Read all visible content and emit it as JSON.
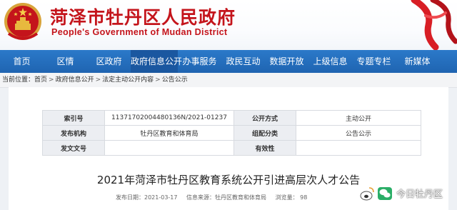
{
  "header": {
    "title": "菏泽市牡丹区人民政府",
    "subtitle": "People's Government of Mudan District"
  },
  "nav": {
    "items": [
      {
        "label": "首页"
      },
      {
        "label": "区情"
      },
      {
        "label": "区政府"
      },
      {
        "label": "政府信息公开"
      },
      {
        "label": "办事服务"
      },
      {
        "label": "政民互动"
      },
      {
        "label": "数据开放"
      },
      {
        "label": "上级信息"
      },
      {
        "label": "专题专栏"
      },
      {
        "label": "新媒体"
      }
    ]
  },
  "breadcrumb": {
    "lead": "当前位置：",
    "items": [
      "首页",
      "政府信息公开",
      "法定主动公开内容",
      "公告公示"
    ]
  },
  "meta": {
    "rows": [
      {
        "k1": "索引号",
        "v1": "11371702004480136N/2021-01237",
        "k2": "公开方式",
        "v2": "主动公开"
      },
      {
        "k1": "发布机构",
        "v1": "牡丹区教育和体育局",
        "k2": "组配分类",
        "v2": "公告公示"
      },
      {
        "k1": "发文文号",
        "v1": "",
        "k2": "有效性",
        "v2": ""
      }
    ]
  },
  "article": {
    "title": "2021年菏泽市牡丹区教育系统公开引进高层次人才公告",
    "publish_date": "发布日期：2021-03-17",
    "source": "信息来源：牡丹区教育和体育局",
    "views": "浏览量：  98"
  },
  "watermark": {
    "text": "今日牡丹区"
  },
  "colors": {
    "brand_red": "#c4141b",
    "nav_blue": "#2b79c9"
  }
}
